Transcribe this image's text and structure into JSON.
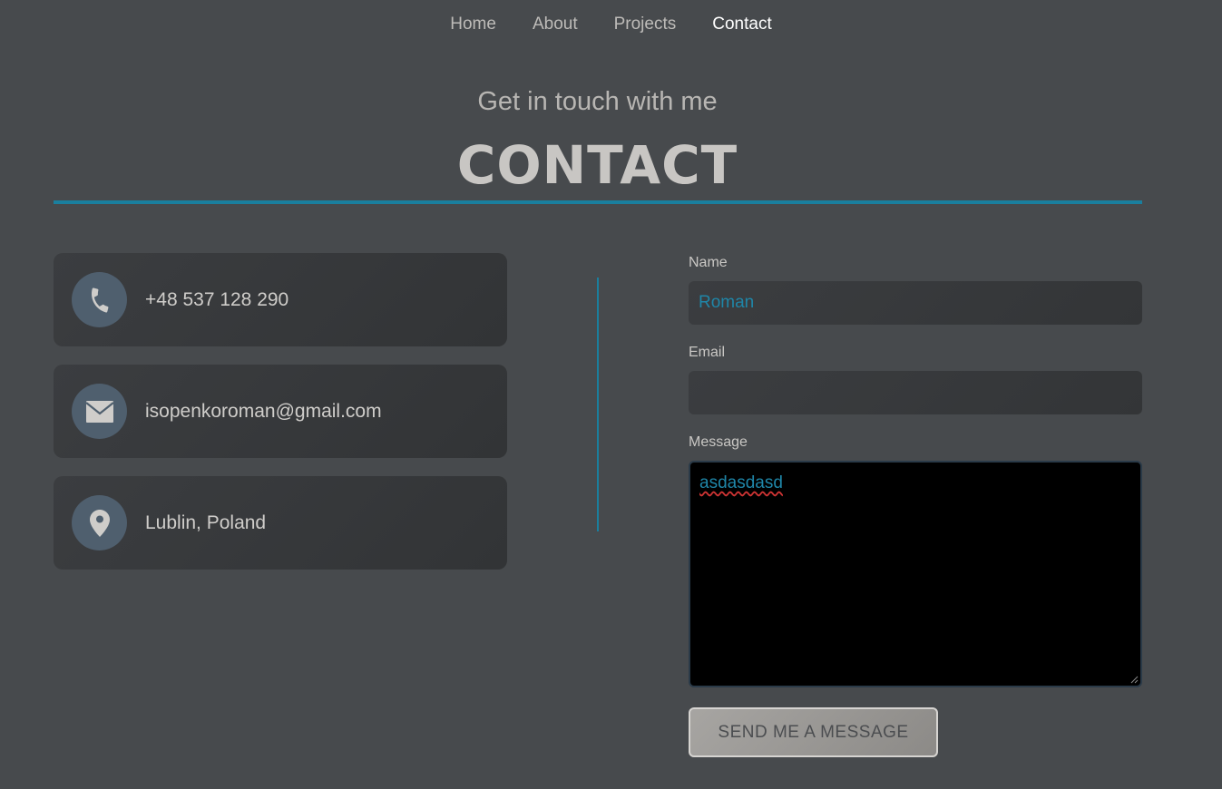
{
  "nav": {
    "items": [
      {
        "label": "Home",
        "active": false
      },
      {
        "label": "About",
        "active": false
      },
      {
        "label": "Projects",
        "active": false
      },
      {
        "label": "Contact",
        "active": true
      }
    ]
  },
  "header": {
    "subtitle": "Get in touch with me",
    "title": "CONTACT"
  },
  "contact_cards": [
    {
      "icon": "phone-icon",
      "text": "+48 537 128 290"
    },
    {
      "icon": "envelope-icon",
      "text": "isopenkoroman@gmail.com"
    },
    {
      "icon": "map-pin-icon",
      "text": "Lublin, Poland"
    }
  ],
  "form": {
    "name_label": "Name",
    "name_value": "Roman",
    "email_label": "Email",
    "email_value": "",
    "message_label": "Message",
    "message_value": "asdasdasd",
    "submit_label": "SEND ME A MESSAGE"
  },
  "colors": {
    "background": "#474a4d",
    "accent": "#1a7f9e",
    "card": "#36383b",
    "icon_circle": "#4f5f6e"
  }
}
